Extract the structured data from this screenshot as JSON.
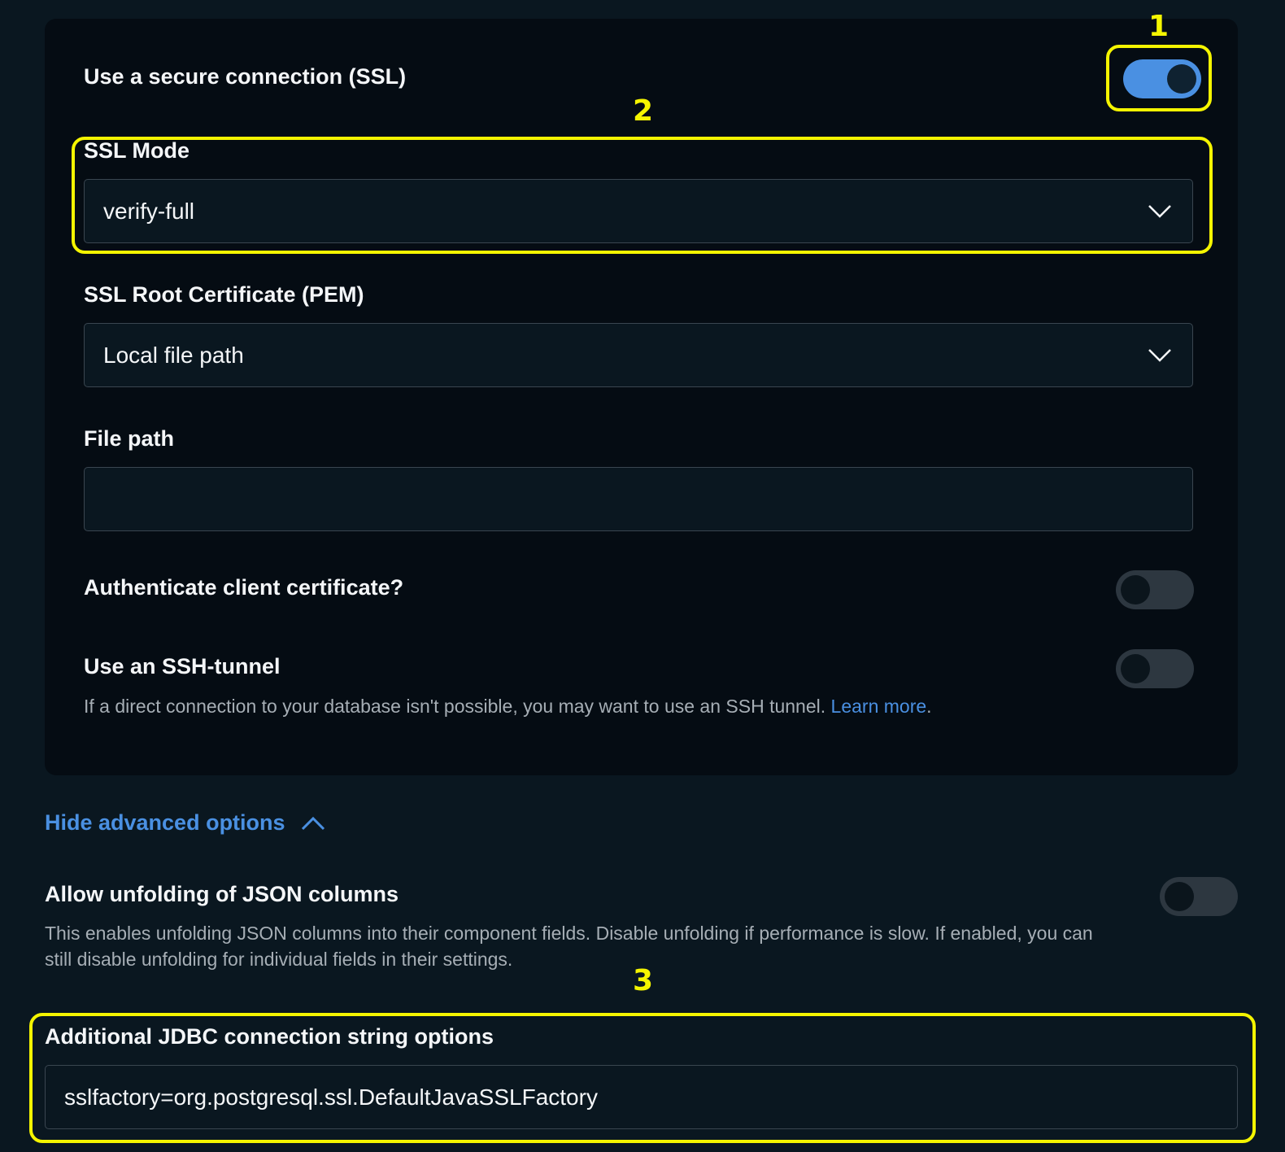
{
  "ssl": {
    "label": "Use a secure connection (SSL)",
    "enabled": true
  },
  "ssl_mode": {
    "label": "SSL Mode",
    "value": "verify-full"
  },
  "root_cert": {
    "label": "SSL Root Certificate (PEM)",
    "value": "Local file path"
  },
  "file_path": {
    "label": "File path",
    "value": ""
  },
  "client_cert": {
    "label": "Authenticate client certificate?",
    "enabled": false
  },
  "ssh_tunnel": {
    "label": "Use an SSH-tunnel",
    "enabled": false,
    "description": "If a direct connection to your database isn't possible, you may want to use an SSH tunnel.",
    "link_text": "Learn more",
    "trailing": "."
  },
  "advanced": {
    "toggle_label": "Hide advanced options"
  },
  "json_unfolding": {
    "label": "Allow unfolding of JSON columns",
    "enabled": false,
    "description": "This enables unfolding JSON columns into their component fields. Disable unfolding if performance is slow. If enabled, you can still disable unfolding for individual fields in their settings."
  },
  "jdbc": {
    "label": "Additional JDBC connection string options",
    "value": "sslfactory=org.postgresql.ssl.DefaultJavaSSLFactory"
  },
  "annotations": {
    "one": "1",
    "two": "2",
    "three": "3"
  },
  "colors": {
    "accent": "#4a90e2",
    "highlight": "#f5f500",
    "background": "#0a1720",
    "card": "#050c13"
  }
}
